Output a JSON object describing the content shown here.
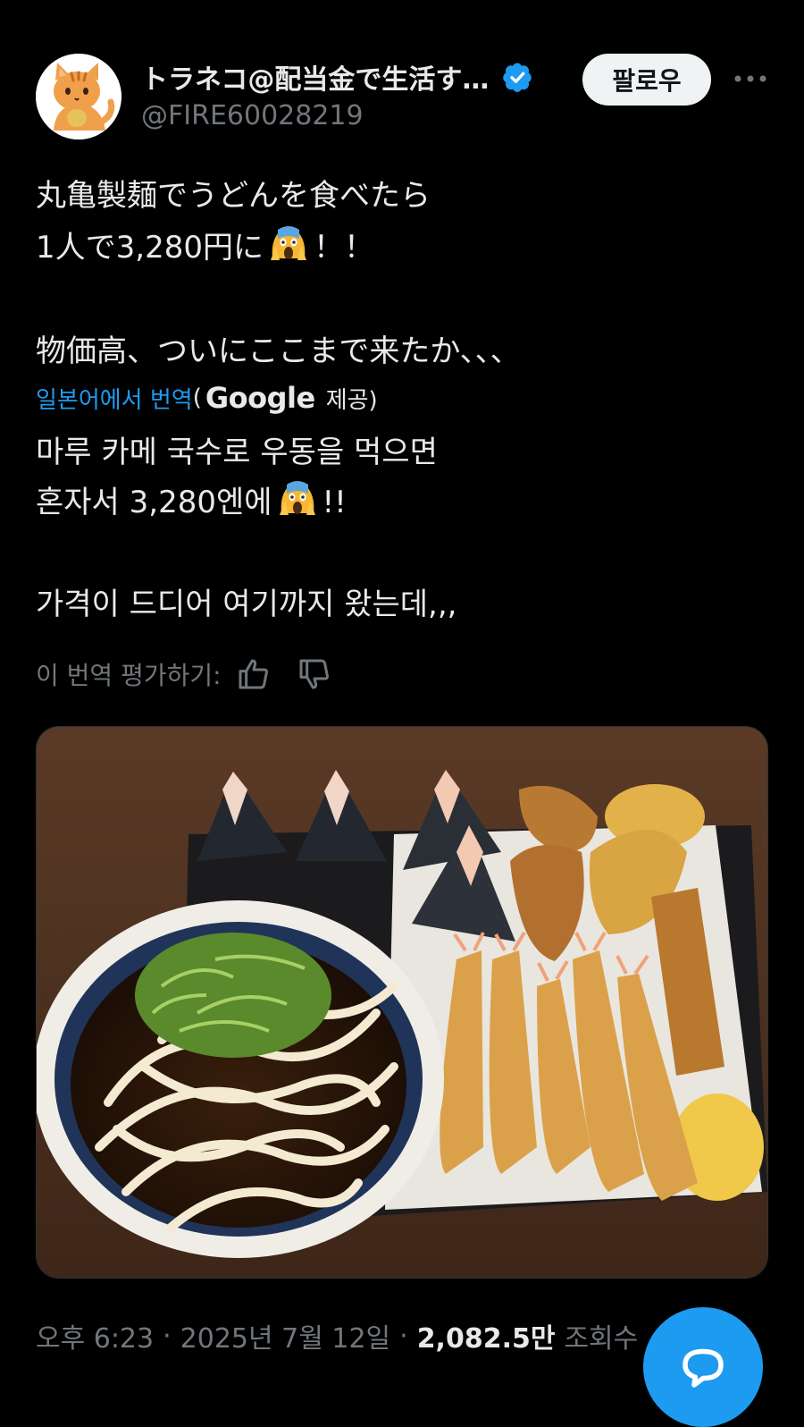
{
  "author": {
    "display_name": "トラネコ@配当金で生活す…",
    "handle": "@FIRE60028219",
    "avatar_icon": "cat-avatar-icon",
    "verified_icon": "verified-badge-icon",
    "verified_color": "#1d9bf0"
  },
  "actions": {
    "follow_label": "팔로우",
    "more_icon": "more-dots-icon"
  },
  "tweet": {
    "line1": "丸亀製麺でうどんを食べたら",
    "line2_before": "1人で3,280円に",
    "line2_emoji": "scream-emoji-icon",
    "line2_after": "！！",
    "line3": "物価高、ついにここまで来たか、、、"
  },
  "translation": {
    "link_label": "일본어에서 번역",
    "paren_open": "(",
    "google_label": "Google",
    "provided_label": "제공)",
    "line1": "마루 카메 국수로 우동을 먹으면",
    "line2_before": "혼자서 3,280엔에",
    "line2_after": "!!",
    "line3": "가격이 드디어 여기까지 왔는데,,,"
  },
  "rating": {
    "label": "이 번역 평가하기:",
    "like_icon": "thumbs-up-icon",
    "dislike_icon": "thumbs-down-icon"
  },
  "meta": {
    "time": "오후 6:23",
    "separator": "·",
    "date": "2025년 7월 12일",
    "views_count": "2,082.5만",
    "views_label": "조회수"
  },
  "compose": {
    "icon": "reply-bubble-icon",
    "accent": "#1d9bf0"
  }
}
